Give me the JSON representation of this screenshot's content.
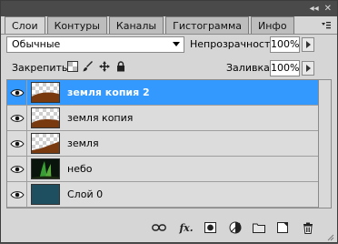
{
  "panel_tabs": [
    {
      "label": "Слои",
      "active": true
    },
    {
      "label": "Контуры",
      "active": false
    },
    {
      "label": "Каналы",
      "active": false
    },
    {
      "label": "Гистограмма",
      "active": false
    },
    {
      "label": "Инфо",
      "active": false
    }
  ],
  "top_controls": {
    "collapse_icon": "double-chevron-icon",
    "close_icon": "close-icon"
  },
  "blend": {
    "mode": "Обычные"
  },
  "opacity": {
    "label": "Непрозрачность:",
    "value": "100%"
  },
  "lock": {
    "label": "Закрепить:",
    "icons": [
      "lock-transparent-icon",
      "brush-icon",
      "move-icon",
      "lock-icon"
    ]
  },
  "fill": {
    "label": "Заливка:",
    "value": "100%"
  },
  "layers": [
    {
      "name": "земля копия 2",
      "selected": true,
      "thumb": "checker-ground"
    },
    {
      "name": "земля копия",
      "selected": false,
      "thumb": "checker-ground"
    },
    {
      "name": "земля",
      "selected": false,
      "thumb": "checker-ground"
    },
    {
      "name": "небо",
      "selected": false,
      "thumb": "sky"
    },
    {
      "name": "Слой 0",
      "selected": false,
      "thumb": "solid"
    }
  ],
  "bottom_icons": [
    "link-icon",
    "fx-icon",
    "mask-icon",
    "adjustment-icon",
    "group-folder-icon",
    "new-layer-icon",
    "trash-icon"
  ],
  "bottom_fx_label": "fx.",
  "colors": {
    "selection": "#3399ff",
    "panel": "#d6d6d6",
    "layer0_fill": "#1d4f60",
    "ground": "#7a3a10"
  }
}
